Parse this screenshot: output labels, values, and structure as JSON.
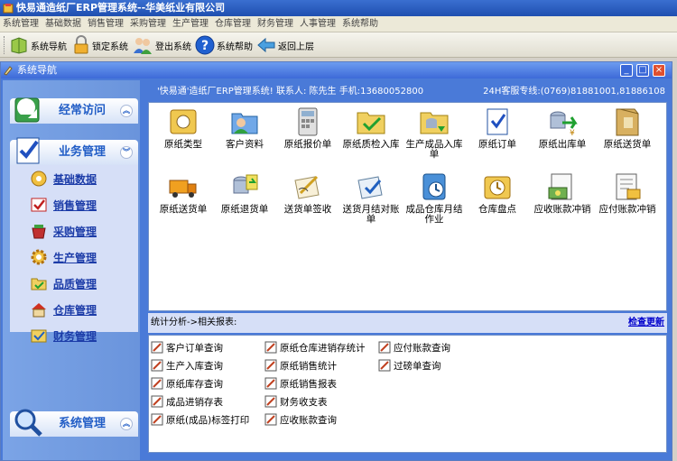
{
  "app_title": "快易通造纸厂ERP管理系统--华美纸业有限公司",
  "menu": [
    "系统管理",
    "基础数据",
    "销售管理",
    "采购管理",
    "生产管理",
    "仓库管理",
    "财务管理",
    "人事管理",
    "系统帮助"
  ],
  "toolbar": {
    "nav": "系统导航",
    "lock": "锁定系统",
    "exit": "登出系统",
    "help": "系统帮助",
    "back": "返回上层"
  },
  "window_title": "系统导航",
  "sidebar": {
    "frequent": "经常访问",
    "business": "业务管理",
    "system": "系统管理",
    "items": [
      "基础数据",
      "销售管理",
      "采购管理",
      "生产管理",
      "品质管理",
      "仓库管理",
      "财务管理"
    ]
  },
  "info": {
    "left": "'快易通'造纸厂ERP管理系统! 联系人:  陈先生  手机:13680052800",
    "right": "24H客服专线:(0769)81881001,81886108"
  },
  "icons": [
    {
      "label": "原纸类型",
      "icon": "paper-type-icon"
    },
    {
      "label": "客户资料",
      "icon": "customer-icon"
    },
    {
      "label": "原纸报价单",
      "icon": "quote-icon"
    },
    {
      "label": "原纸质检入库",
      "icon": "qc-inbound-icon"
    },
    {
      "label": "生产成品入库单",
      "icon": "product-inbound-icon"
    },
    {
      "label": "原纸订单",
      "icon": "order-icon"
    },
    {
      "label": "原纸出库单",
      "icon": "outbound-icon"
    },
    {
      "label": "原纸送货单",
      "icon": "delivery-folder-icon"
    },
    {
      "label": "原纸送货单",
      "icon": "truck-icon"
    },
    {
      "label": "原纸退货单",
      "icon": "return-icon"
    },
    {
      "label": "送货单签收",
      "icon": "sign-icon"
    },
    {
      "label": "送货月结对账单",
      "icon": "reconcile-icon"
    },
    {
      "label": "成品仓库月结作业",
      "icon": "monthly-close-icon"
    },
    {
      "label": "仓库盘点",
      "icon": "stocktake-icon"
    },
    {
      "label": "应收账款冲销",
      "icon": "receivable-icon"
    },
    {
      "label": "应付账款冲销",
      "icon": "payable-icon"
    }
  ],
  "stats": {
    "header": "统计分析->相关报表:",
    "refresh": "检查更新"
  },
  "reports": {
    "col1": [
      "客户订单查询",
      "生产入库查询",
      "原纸库存查询",
      "成品进销存表",
      "原纸(成品)标签打印"
    ],
    "col2": [
      "原纸仓库进销存统计",
      "原纸销售统计",
      "原纸销售报表",
      "财务收支表",
      "应收账款查询"
    ],
    "col3": [
      "应付账款查询",
      "过磅单查询"
    ]
  }
}
